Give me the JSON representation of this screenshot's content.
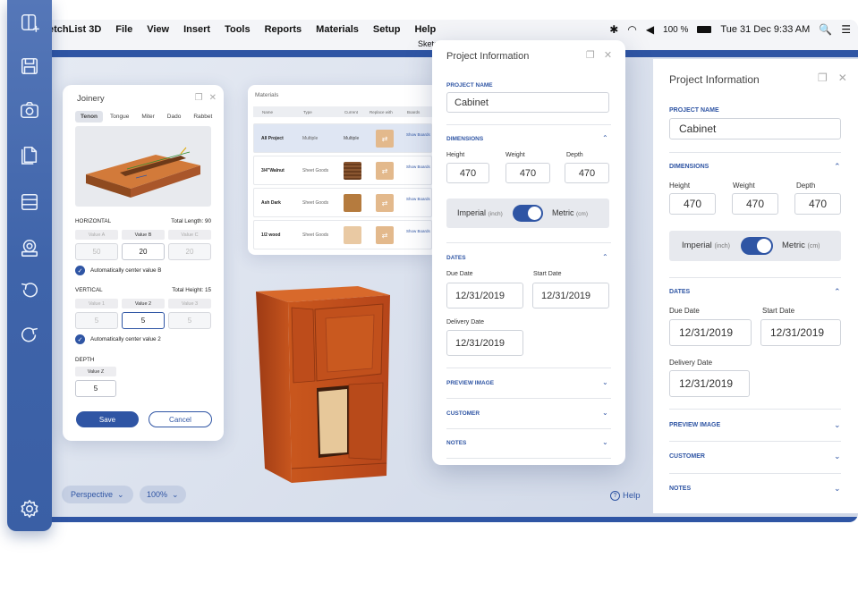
{
  "menubar": {
    "app_name": "etchList 3D",
    "menus": [
      "File",
      "View",
      "Insert",
      "Tools",
      "Reports",
      "Materials",
      "Setup",
      "Help"
    ],
    "battery": "100 %",
    "datetime": "Tue 31 Dec  9:33 AM"
  },
  "window_title": "SketchList 3D Li",
  "joinery": {
    "title": "Joinery",
    "tabs": [
      "Tenon",
      "Tongue",
      "Miter",
      "Dado",
      "Rabbet"
    ],
    "horizontal": {
      "label": "HORIZONTAL",
      "total": "Total Length: 90",
      "options": [
        "Value A",
        "Value B",
        "Value C"
      ],
      "values": [
        "50",
        "20",
        "20"
      ],
      "check": "Automatically center value B"
    },
    "vertical": {
      "label": "VERTICAL",
      "total": "Total Height: 15",
      "options": [
        "Value 1",
        "Value 2",
        "Value 3"
      ],
      "values": [
        "5",
        "5",
        "5"
      ],
      "check": "Automatically center value 2"
    },
    "depth": {
      "label": "DEPTH",
      "option": "Value Z",
      "value": "5"
    },
    "save": "Save",
    "cancel": "Cancel"
  },
  "materials": {
    "title": "Materials",
    "columns": [
      "Name",
      "Type",
      "Current",
      "Replace with",
      "Boards"
    ],
    "rows": [
      {
        "name": "All Project",
        "type": "Multiple",
        "current": "Multiple",
        "show": "Show Boards",
        "swatch": ""
      },
      {
        "name": "3/4\"Walnut",
        "type": "Sheet Goods",
        "current": "",
        "show": "Show Boards",
        "swatch": "#7a4a26"
      },
      {
        "name": "Ash Dark",
        "type": "Sheet Goods",
        "current": "",
        "show": "Show Boards",
        "swatch": "#b57b3e"
      },
      {
        "name": "1/2 wood",
        "type": "Sheet Goods",
        "current": "",
        "show": "Show Boards",
        "swatch": "#e9c9a3"
      }
    ]
  },
  "view_controls": {
    "perspective": "Perspective",
    "zoom": "100%",
    "help": "Help"
  },
  "project_info": {
    "title": "Project Information",
    "project_name_label": "PROJECT NAME",
    "project_name": "Cabinet",
    "dimensions_label": "DIMENSIONS",
    "height_label": "Height",
    "weight_label": "Weight",
    "depth_label": "Depth",
    "height": "470",
    "weight": "470",
    "depth": "470",
    "imperial": "Imperial",
    "imperial_sub": "(inch)",
    "metric": "Metric",
    "metric_sub": "(cm)",
    "dates_label": "DATES",
    "due_date_label": "Due Date",
    "start_date_label": "Start Date",
    "due_date": "12/31/2019",
    "start_date": "12/31/2019",
    "delivery_date_label": "Delivery Date",
    "delivery_date": "12/31/2019",
    "preview_image": "PREVIEW IMAGE",
    "customer": "CUSTOMER",
    "notes": "NOTES"
  },
  "colors": {
    "accent": "#2f55a4",
    "toolbar": "#4366ad",
    "wood": "#c4541c"
  }
}
